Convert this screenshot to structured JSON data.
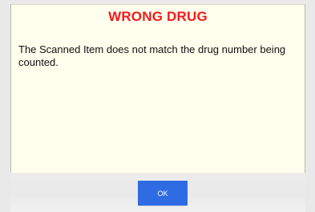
{
  "dialog": {
    "title": "WRONG DRUG",
    "message": "The Scanned Item does not match the drug number being counted.",
    "title_color": "#f41a1a",
    "background_color": "#ffffed"
  },
  "footer": {
    "ok_label": "OK",
    "button_color": "#2f6ce3"
  }
}
